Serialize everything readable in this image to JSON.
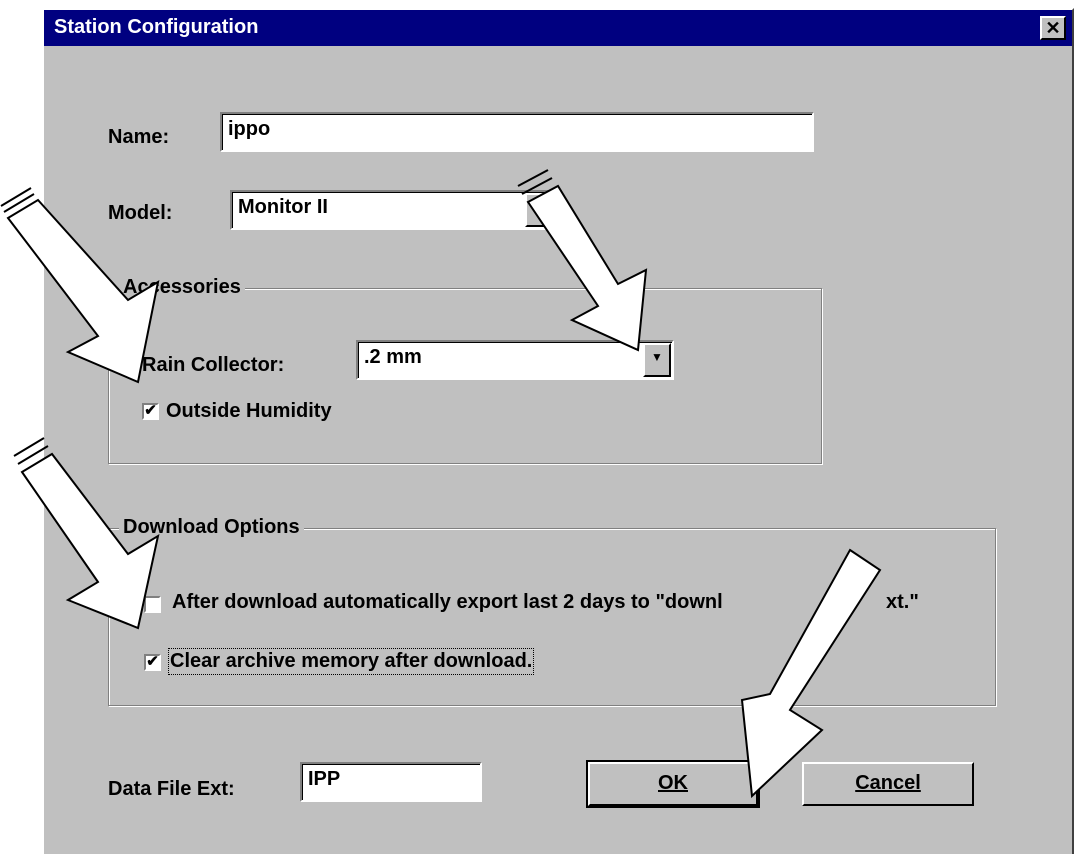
{
  "window": {
    "title": "Station Configuration",
    "close_glyph": "✕"
  },
  "name_field": {
    "label": "Name:",
    "value": "ippo"
  },
  "model_field": {
    "label": "Model:",
    "value": "Monitor II"
  },
  "accessories": {
    "legend": "Accessories",
    "rain_collector_label": "Rain Collector:",
    "rain_collector_value": ".2 mm",
    "outside_humidity": {
      "label": "Outside Humidity",
      "checked": true
    }
  },
  "download_options": {
    "legend": "Download Options",
    "auto_export": {
      "label": "After download automatically export last 2 days to \"downl",
      "label_tail": "xt.\"",
      "checked": false
    },
    "clear_archive": {
      "label": "Clear archive memory after download.",
      "checked": true
    }
  },
  "data_file_ext": {
    "label": "Data File Ext:",
    "value": "IPP"
  },
  "buttons": {
    "ok": "OK",
    "cancel": "Cancel"
  },
  "icons": {
    "dropdown": "dropdown-arrow-icon",
    "check": "check-icon",
    "pointer": "pointer-arrow-icon"
  },
  "colors": {
    "titlebar": "#000080",
    "dialog": "#c0c0c0"
  }
}
